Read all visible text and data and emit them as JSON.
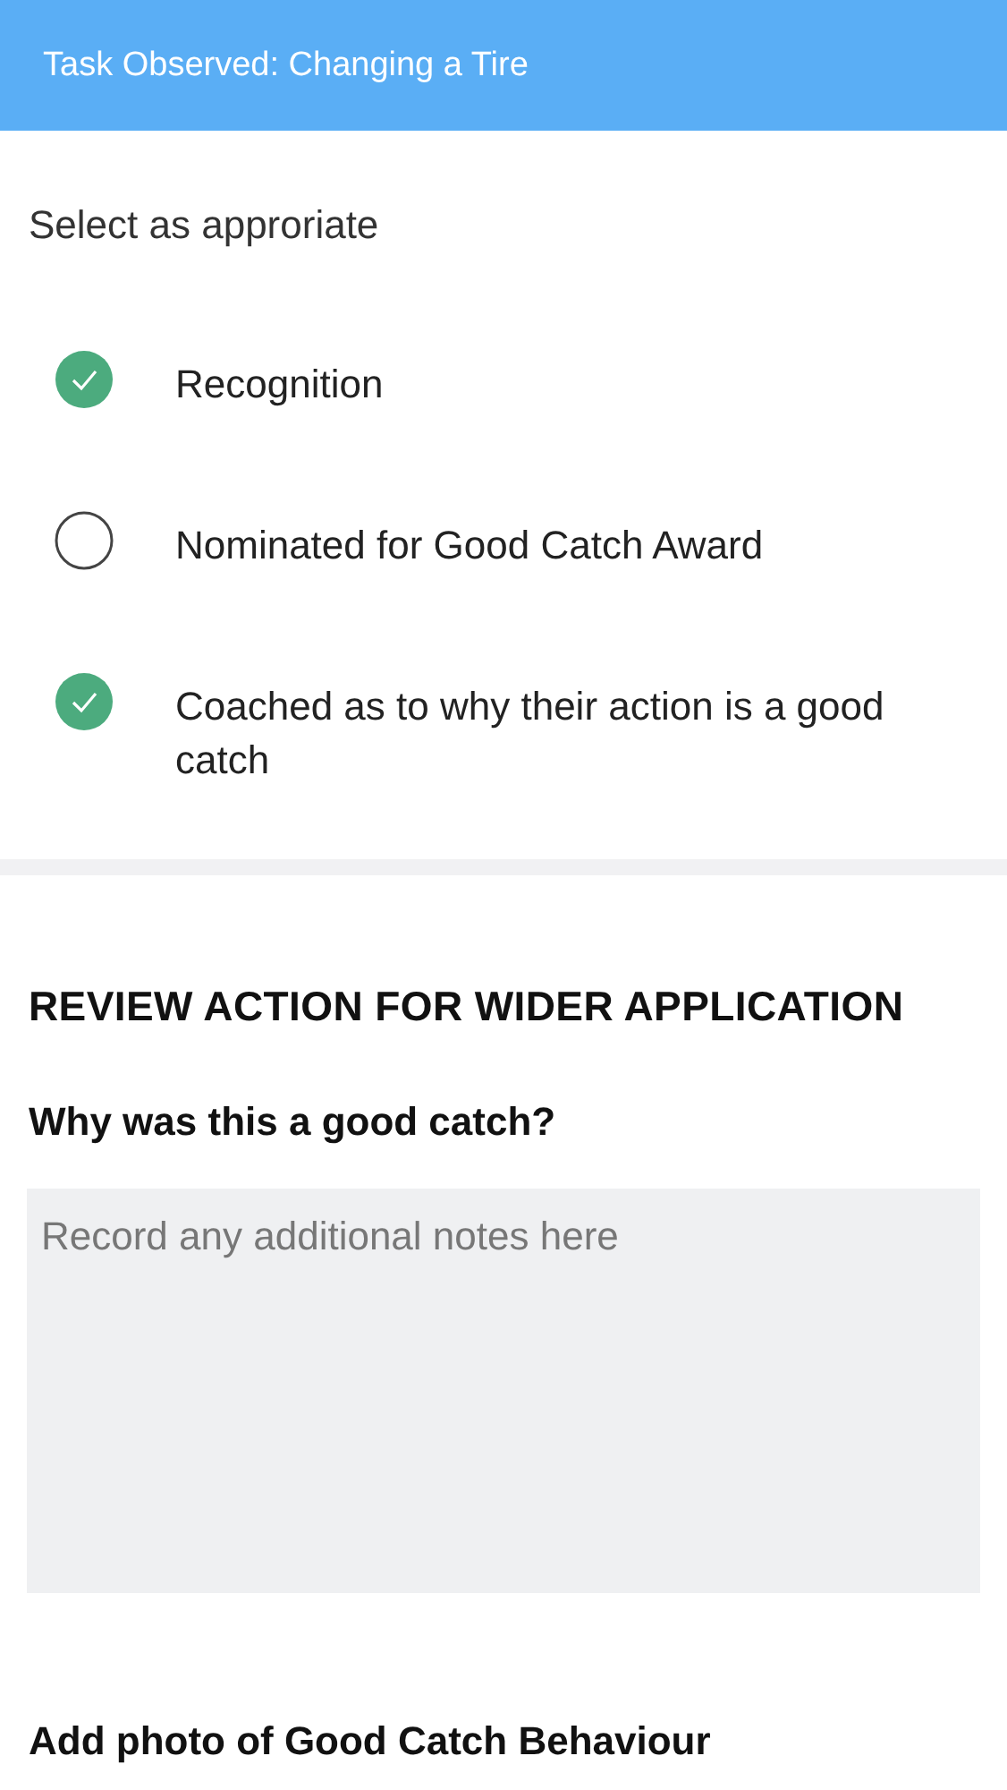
{
  "header": {
    "title": "Task Observed: Changing a Tire"
  },
  "select_section": {
    "heading": "Select as approriate",
    "options": [
      {
        "label": "Recognition",
        "checked": true
      },
      {
        "label": "Nominated for Good Catch Award",
        "checked": false
      },
      {
        "label": "Coached as to why their action is a good catch",
        "checked": true
      }
    ]
  },
  "review_section": {
    "heading": "REVIEW ACTION FOR WIDER APPLICATION",
    "question": "Why was this a good catch?",
    "notes_field": {
      "placeholder": "Record any additional notes here"
    },
    "photo_heading": "Add photo of Good Catch Behaviour"
  }
}
